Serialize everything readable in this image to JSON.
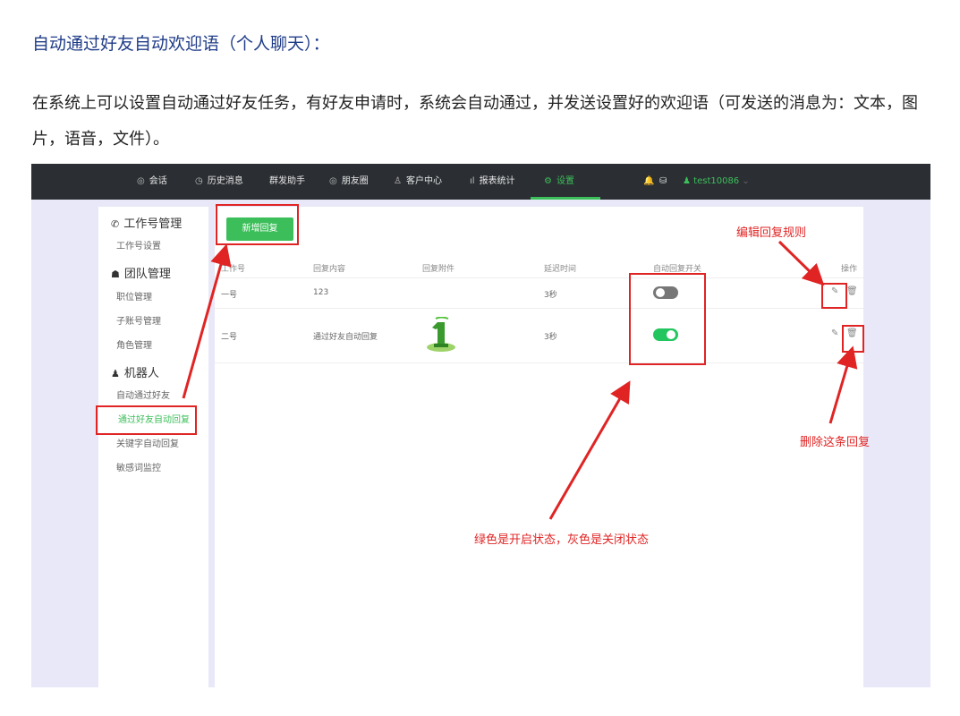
{
  "doc": {
    "title": "自动通过好友自动欢迎语",
    "title_paren": "（个人聊天）：",
    "body": "在系统上可以设置自动通过好友任务，有好友申请时，系统会自动通过，并发送设置好的欢迎语（可发送的消息为：文本，图片，语音，文件）。"
  },
  "nav": {
    "items": [
      {
        "icon": "chat-icon",
        "glyph": "◎",
        "label": "会话"
      },
      {
        "icon": "history-icon",
        "glyph": "◷",
        "label": "历史消息"
      },
      {
        "icon": "",
        "glyph": "",
        "label": "群发助手"
      },
      {
        "icon": "moments-icon",
        "glyph": "◎",
        "label": "朋友圈"
      },
      {
        "icon": "customer-icon",
        "glyph": "♙",
        "label": "客户中心"
      },
      {
        "icon": "report-icon",
        "glyph": "ıl",
        "label": "报表统计"
      },
      {
        "icon": "settings-icon",
        "glyph": "⚙",
        "label": "设置"
      }
    ],
    "active_label": "设置",
    "user": "test10086",
    "bell_glyph": "🔔",
    "db_glyph": "⛁"
  },
  "sidebar": {
    "groups": [
      {
        "label": "工作号管理",
        "icon": "wechat-icon",
        "glyph": "✆",
        "items": [
          "工作号设置"
        ]
      },
      {
        "label": "团队管理",
        "icon": "team-icon",
        "glyph": "☗",
        "items": [
          "职位管理",
          "子账号管理",
          "角色管理"
        ]
      },
      {
        "label": "机器人",
        "icon": "robot-icon",
        "glyph": "♟",
        "items": [
          "自动通过好友",
          "通过好友自动回复",
          "关键字自动回复",
          "敏感词监控"
        ]
      }
    ],
    "selected": "通过好友自动回复"
  },
  "toolbar": {
    "add_label": "新增回复"
  },
  "table": {
    "headers": [
      "工作号",
      "回复内容",
      "回复附件",
      "延迟时间",
      "自动回复开关",
      "操作"
    ],
    "rows": [
      {
        "account": "一号",
        "content": "123",
        "attachment": "",
        "delay": "3秒",
        "enabled": false
      },
      {
        "account": "二号",
        "content": "通过好友自动回复",
        "attachment": "image",
        "delay": "3秒",
        "enabled": true
      }
    ]
  },
  "annotations": {
    "edit": "编辑回复规则",
    "delete": "删除这条回复",
    "toggle": "绿色是开启状态，灰色是关闭状态"
  },
  "colors": {
    "accent_green": "#3cbf5a",
    "annotation_red": "#e02424",
    "nav_bg": "#2b2f33",
    "title_blue": "#1f3c88"
  }
}
